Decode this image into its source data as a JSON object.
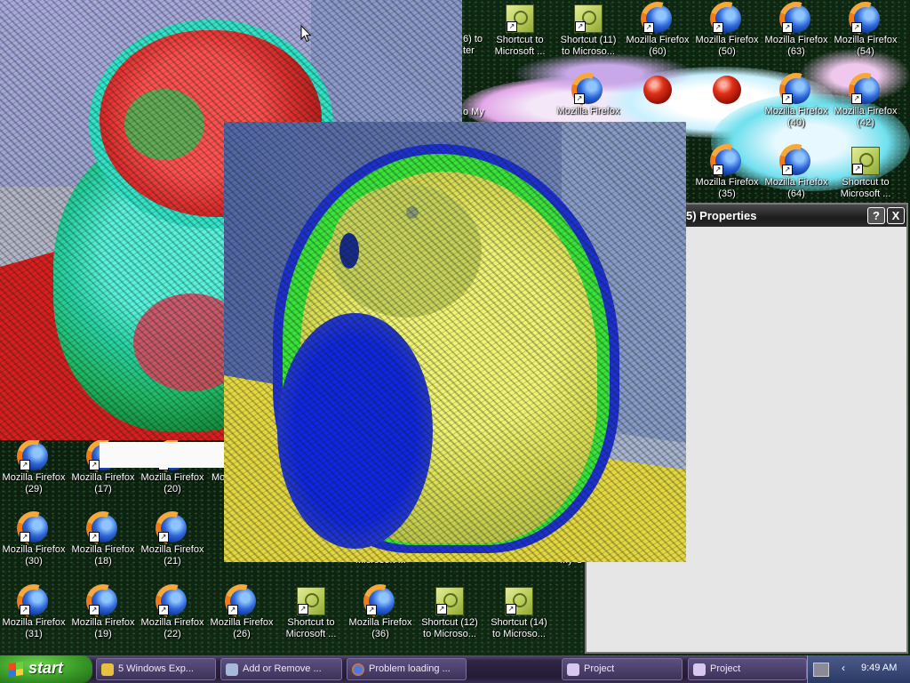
{
  "colors": {
    "desktop_bg": "#0c200f",
    "taskbar_bg": "#2e2444",
    "start_green": "#3a9a28",
    "dialog_body": "#e6e6e6",
    "dialog_title": "#1c1c1c"
  },
  "desktop": {
    "fragments": {
      "top_row1_line1": "6) to",
      "top_row1_line2": "ter",
      "top_row2_line1": "o My",
      "bottom_row1": "Mo",
      "bottom_row2_a": "Microsoft ...",
      "bottom_row2_b": "My C"
    },
    "top_row1": [
      {
        "icon": "shortcut-icon",
        "l1": "Shortcut to",
        "l2": "Microsoft ..."
      },
      {
        "icon": "shortcut-icon",
        "l1": "Shortcut (11)",
        "l2": "to Microso..."
      },
      {
        "icon": "firefox-icon",
        "l1": "Mozilla Firefox",
        "l2": "(60)"
      },
      {
        "icon": "firefox-icon",
        "l1": "Mozilla Firefox",
        "l2": "(50)"
      },
      {
        "icon": "firefox-icon",
        "l1": "Mozilla Firefox",
        "l2": "(63)"
      },
      {
        "icon": "firefox-icon",
        "l1": "Mozilla Firefox",
        "l2": "(54)"
      }
    ],
    "top_row2": [
      {
        "icon": "firefox-icon",
        "l1": "Mozilla Firefox",
        "l2": ""
      },
      {
        "icon": "red-orb-icon",
        "l1": "",
        "l2": ""
      },
      {
        "icon": "red-orb-icon",
        "l1": "",
        "l2": ""
      },
      {
        "icon": "firefox-icon",
        "l1": "Mozilla Firefox",
        "l2": "(40)"
      },
      {
        "icon": "firefox-icon",
        "l1": "Mozilla Firefox",
        "l2": "(42)"
      }
    ],
    "top_row3": [
      {
        "icon": "firefox-icon",
        "l1": "Mozilla Firefox",
        "l2": "(35)"
      },
      {
        "icon": "firefox-icon",
        "l1": "Mozilla Firefox",
        "l2": "(64)"
      },
      {
        "icon": "shortcut-icon",
        "l1": "Shortcut to",
        "l2": "Microsoft ..."
      }
    ],
    "bottom_row1": [
      {
        "icon": "firefox-icon",
        "l1": "Mozilla Firefox",
        "l2": "(29)"
      },
      {
        "icon": "firefox-icon",
        "l1": "Mozilla Firefox",
        "l2": "(17)"
      },
      {
        "icon": "firefox-icon",
        "l1": "Mozilla Firefox",
        "l2": "(20)"
      }
    ],
    "bottom_row2": [
      {
        "icon": "firefox-icon",
        "l1": "Mozilla Firefox",
        "l2": "(30)"
      },
      {
        "icon": "firefox-icon",
        "l1": "Mozilla Firefox",
        "l2": "(18)"
      },
      {
        "icon": "firefox-icon",
        "l1": "Mozilla Firefox",
        "l2": "(21)"
      }
    ],
    "bottom_row3": [
      {
        "icon": "firefox-icon",
        "l1": "Mozilla Firefox",
        "l2": "(31)"
      },
      {
        "icon": "firefox-icon",
        "l1": "Mozilla Firefox",
        "l2": "(19)"
      },
      {
        "icon": "firefox-icon",
        "l1": "Mozilla Firefox",
        "l2": "(22)"
      },
      {
        "icon": "firefox-icon",
        "l1": "Mozilla Firefox",
        "l2": "(26)"
      },
      {
        "icon": "shortcut-icon",
        "l1": "Shortcut to",
        "l2": "Microsoft ..."
      },
      {
        "icon": "firefox-icon",
        "l1": "Mozilla Firefox",
        "l2": "(36)"
      },
      {
        "icon": "shortcut-icon",
        "l1": "Shortcut (12)",
        "l2": "to Microso..."
      },
      {
        "icon": "shortcut-icon",
        "l1": "Shortcut (14)",
        "l2": "to Microso..."
      }
    ]
  },
  "dialog": {
    "title": "5) Properties",
    "help_label": "?",
    "close_label": "X"
  },
  "taskbar": {
    "start_label": "start",
    "tasks": [
      {
        "label": "5 Windows Exp...",
        "icon": "folder-icon"
      },
      {
        "label": "Add or Remove ...",
        "icon": "add-remove-icon"
      },
      {
        "label": "Problem loading ...",
        "icon": "firefox-icon"
      },
      {
        "label": "Project",
        "icon": "project-icon"
      },
      {
        "label": "Project",
        "icon": "project-icon"
      }
    ],
    "clock": "9:49 AM"
  }
}
